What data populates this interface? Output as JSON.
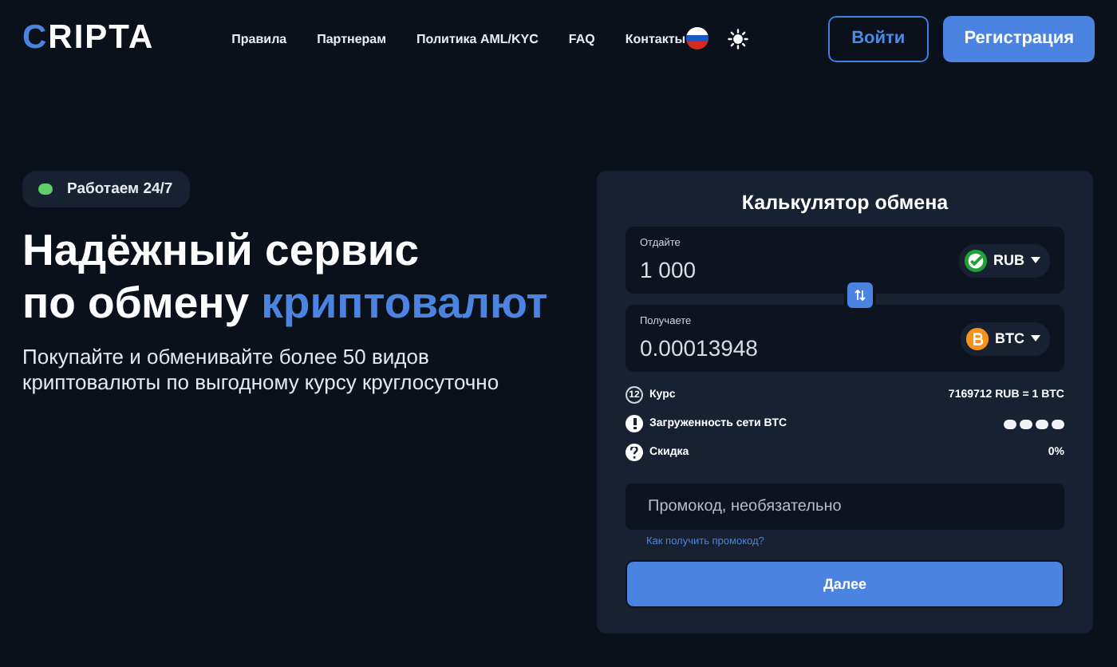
{
  "header": {
    "logo_accent": "C",
    "logo_rest": "RIPTA",
    "nav": [
      "Правила",
      "Партнерам",
      "Политика AML/KYC",
      "FAQ",
      "Контакты"
    ],
    "login": "Войти",
    "register": "Регистрация"
  },
  "hero": {
    "badge": {
      "text": "Работаем 24/7",
      "color": "#5fd068"
    },
    "title_line1": "Надёжный сервис",
    "title_line2_plain": "по обмену",
    "title_line2_accent": "криптовалют",
    "subtitle": "Покупайте и обменивайте более 50 видов криптовалюты по выгодному курсу круглосуточно"
  },
  "calculator": {
    "title": "Калькулятор обмена",
    "fields": [
      {
        "label": "Отдайте",
        "value": "1 000",
        "currency": "RUB",
        "kind": "rub"
      },
      {
        "label": "Получаете",
        "value": "0.00013948",
        "currency": "BTC",
        "kind": "btc"
      }
    ],
    "info": [
      {
        "kind": "timer",
        "icon_text": "12",
        "label": "Курс",
        "value": "7169712 RUB = 1 BTC"
      },
      {
        "kind": "meter",
        "label": "Загруженность сети BTC"
      },
      {
        "kind": "help",
        "label": "Скидка",
        "value": "0%"
      }
    ],
    "promo": {
      "placeholder": "Промокод, необязательно"
    },
    "promo_link": "Как получить промокод?",
    "submit": "Далее"
  }
}
